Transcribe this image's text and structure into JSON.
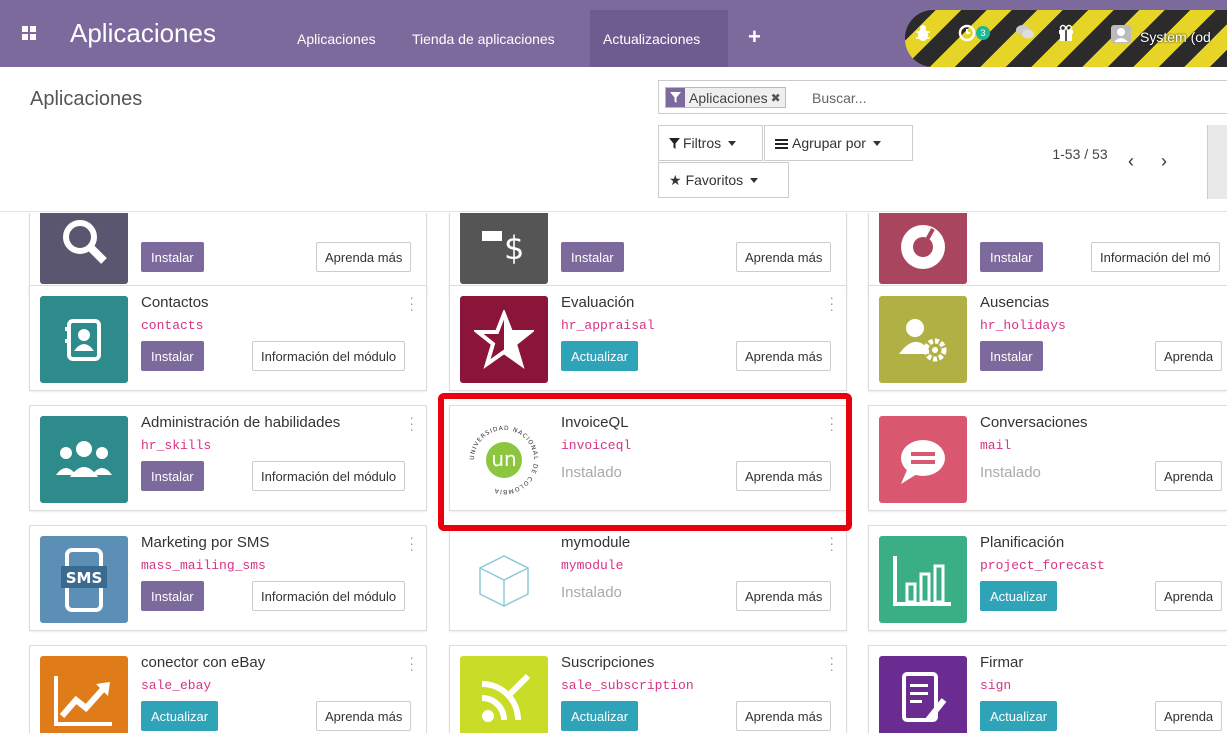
{
  "navbar": {
    "brand": "Aplicaciones",
    "menu": [
      {
        "label": "Aplicaciones",
        "active": false
      },
      {
        "label": "Tienda de aplicaciones",
        "active": false
      },
      {
        "label": "Actualizaciones",
        "active": true
      }
    ],
    "plus": "+",
    "activity_count": "3",
    "user": "System (od"
  },
  "control_panel": {
    "title": "Aplicaciones",
    "facet_label": "Aplicaciones",
    "search_placeholder": "Buscar...",
    "filters_label": "Filtros",
    "groupby_label": "Agrupar por",
    "favorites_label": "Favoritos",
    "pager_value": "1-53 / 53"
  },
  "colors": {
    "brand": "#7c6a9d",
    "update": "#2fa3b8",
    "technical_name": "#d63384",
    "highlight": "#e8000f"
  },
  "cards": [
    {
      "name": "",
      "tech": "",
      "icon": "magnifier-icon",
      "icon_color": "#5b5670",
      "primary": "Instalar",
      "secondary": "Aprenda más"
    },
    {
      "name": "",
      "tech": "",
      "icon": "expense-icon",
      "icon_color": "#555555",
      "primary": "Instalar",
      "secondary": "Aprenda más"
    },
    {
      "name": "",
      "tech": "",
      "icon": "gauge-icon",
      "icon_color": "#a9455f",
      "primary": "Instalar",
      "secondary": "Información del mó"
    },
    {
      "name": "Contactos",
      "tech": "contacts",
      "icon": "address-book-icon",
      "icon_color": "#2e8b8b",
      "primary": "Instalar",
      "secondary": "Información del módulo"
    },
    {
      "name": "Evaluación",
      "tech": "hr_appraisal",
      "icon": "star-icon",
      "icon_color": "#8b1538",
      "primary": "Actualizar",
      "secondary": "Aprenda más"
    },
    {
      "name": "Ausencias",
      "tech": "hr_holidays",
      "icon": "user-gear-icon",
      "icon_color": "#b0b045",
      "primary": "Instalar",
      "secondary": "Aprenda"
    },
    {
      "name": "Administración de habilidades",
      "tech": "hr_skills",
      "icon": "team-icon",
      "icon_color": "#2e8b8b",
      "primary": "Instalar",
      "secondary": "Información del módulo"
    },
    {
      "name": "InvoiceQL",
      "tech": "invoiceql",
      "icon": "university-seal-icon",
      "icon_color": "#ffffff",
      "installed": "Instalado",
      "secondary": "Aprenda más",
      "logo_text": "un",
      "seal_text": "UNIVERSIDAD NACIONAL DE COLOMBIA"
    },
    {
      "name": "Conversaciones",
      "tech": "mail",
      "icon": "chat-bubble-icon",
      "icon_color": "#d9576f",
      "installed": "Instalado",
      "secondary": "Aprenda"
    },
    {
      "name": "Marketing por SMS",
      "tech": "mass_mailing_sms",
      "icon": "sms-phone-icon",
      "icon_color": "#5b8fb5",
      "primary": "Instalar",
      "secondary": "Información del módulo",
      "icon_text": "SMS"
    },
    {
      "name": "mymodule",
      "tech": "mymodule",
      "icon": "cube-icon",
      "icon_color": "#ffffff",
      "installed": "Instalado",
      "secondary": "Aprenda más"
    },
    {
      "name": "Planificación",
      "tech": "project_forecast",
      "icon": "bar-chart-icon",
      "icon_color": "#3aaf85",
      "primary": "Actualizar",
      "secondary": "Aprenda"
    },
    {
      "name": "conector con eBay",
      "tech": "sale_ebay",
      "icon": "trend-up-icon",
      "icon_color": "#e07b1a",
      "primary": "Actualizar",
      "secondary": "Aprenda más"
    },
    {
      "name": "Suscripciones",
      "tech": "sale_subscription",
      "icon": "rss-pen-icon",
      "icon_color": "#c8dc28",
      "primary": "Actualizar",
      "secondary": "Aprenda más"
    },
    {
      "name": "Firmar",
      "tech": "sign",
      "icon": "sign-document-icon",
      "icon_color": "#6a2c91",
      "primary": "Actualizar",
      "secondary": "Aprenda"
    }
  ]
}
